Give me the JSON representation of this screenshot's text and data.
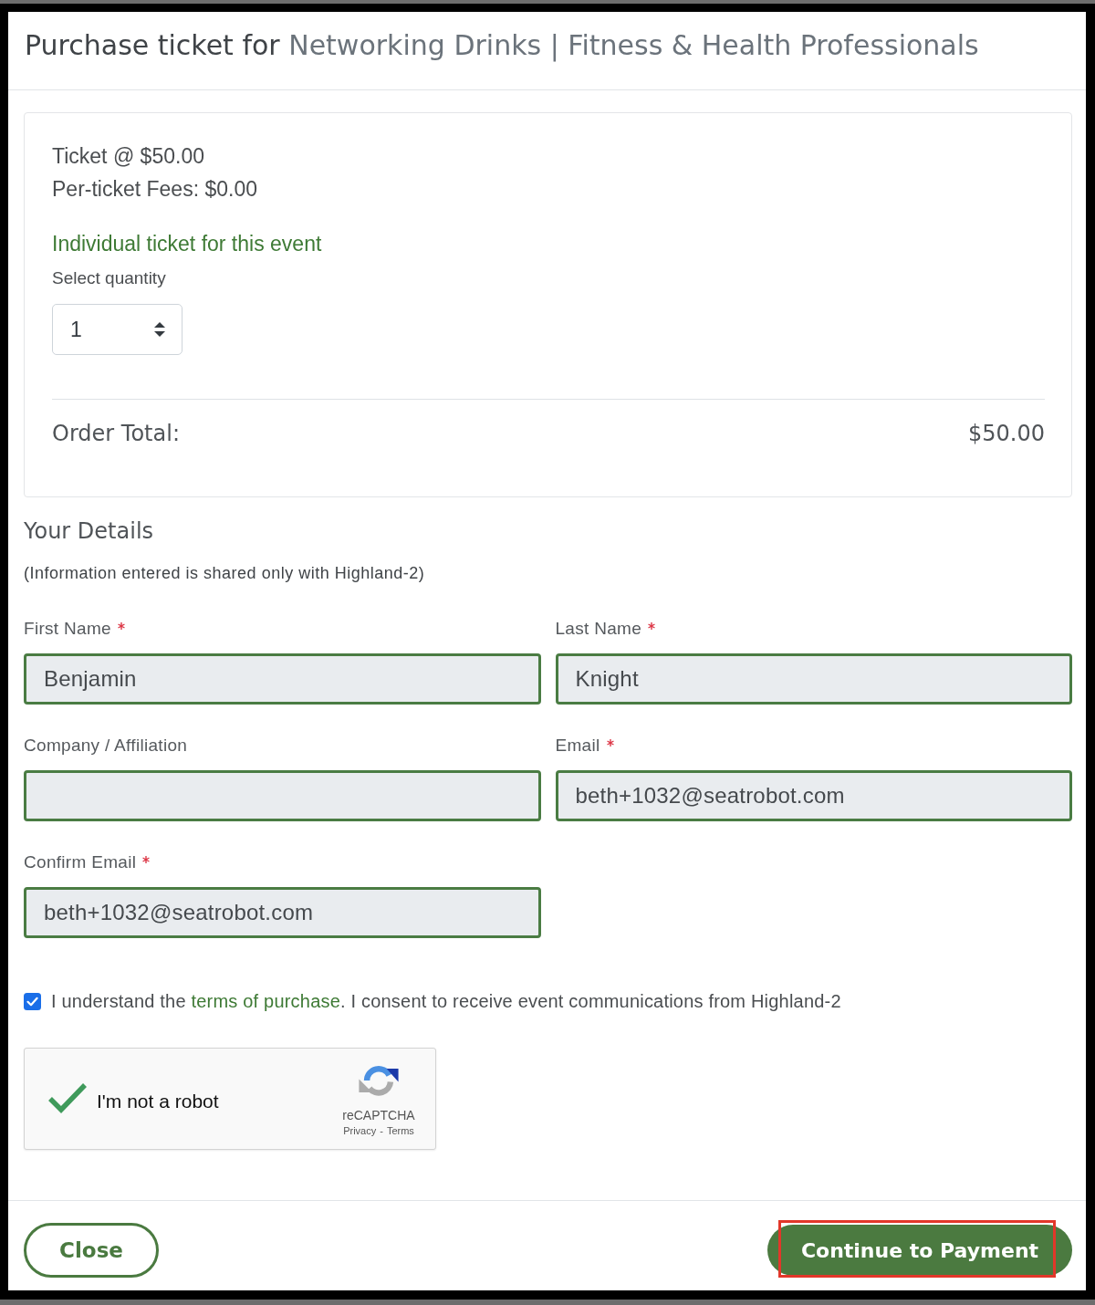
{
  "dialog": {
    "title_prefix": "Purchase ticket for",
    "event_name": "Networking Drinks | Fitness & Health Professionals"
  },
  "ticket": {
    "price_line": "Ticket @ $50.00",
    "fees_line": "Per-ticket Fees: $0.00",
    "ticket_type": "Individual ticket for this event",
    "quantity_label": "Select quantity",
    "quantity": "1",
    "total_label": "Order Total:",
    "total_value": "$50.00"
  },
  "details": {
    "heading": "Your Details",
    "note": "(Information entered is shared only with Highland-2)",
    "fields": [
      {
        "label": "First Name",
        "required": true,
        "valid": true,
        "value": "Benjamin"
      },
      {
        "label": "Last Name",
        "required": true,
        "valid": true,
        "value": "Knight"
      },
      {
        "label": "Company / Affiliation",
        "required": false,
        "valid": true
      },
      {
        "label": "Email",
        "required": true,
        "valid": true,
        "value": "beth+1032@seatrobot.com"
      },
      {
        "label": "Confirm Email",
        "required": true,
        "valid": true,
        "value": "beth+1032@seatrobot.com"
      }
    ]
  },
  "consent": {
    "checked": true,
    "text_before": "I understand the",
    "link": "terms of purchase",
    "text_after": ". I consent to receive event communications from Highland-2"
  },
  "recaptcha": {
    "checked": true,
    "label": "I'm not a robot",
    "brand": "reCAPTCHA",
    "links": [
      "Privacy",
      "Terms"
    ],
    "separator": "-"
  },
  "footer": {
    "buttons": [
      {
        "label": "Close",
        "kind": "outline",
        "highlighted": false
      },
      {
        "label": "Continue to Payment",
        "kind": "primary",
        "highlighted": true
      }
    ]
  }
}
